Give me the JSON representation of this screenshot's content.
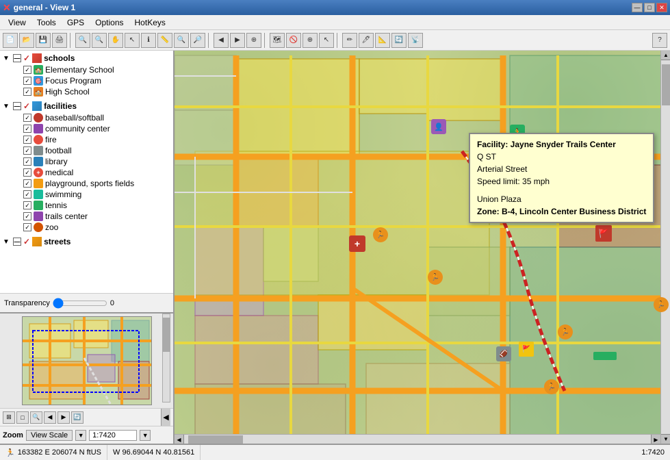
{
  "titleBar": {
    "title": "general - View 1",
    "minBtn": "—",
    "maxBtn": "□",
    "closeBtn": "✕"
  },
  "menuBar": {
    "items": [
      "View",
      "Tools",
      "GPS",
      "Options",
      "HotKeys"
    ]
  },
  "toolbar": {
    "helpBtn": "?"
  },
  "layerTree": {
    "schools": {
      "label": "schools",
      "children": [
        {
          "label": "Elementary School",
          "iconColor": "#27ae60",
          "iconShape": "square"
        },
        {
          "label": "Focus Program",
          "iconColor": "#3498db",
          "iconShape": "square"
        },
        {
          "label": "High School",
          "iconColor": "#e67e22",
          "iconShape": "square"
        }
      ]
    },
    "facilities": {
      "label": "facilities",
      "children": [
        {
          "label": "baseball/softball",
          "iconColor": "#c0392b",
          "iconShape": "circle"
        },
        {
          "label": "community center",
          "iconColor": "#8e44ad",
          "iconShape": "square"
        },
        {
          "label": "fire",
          "iconColor": "#e74c3c",
          "iconShape": "circle"
        },
        {
          "label": "football",
          "iconColor": "#7f8c8d",
          "iconShape": "square"
        },
        {
          "label": "library",
          "iconColor": "#2980b9",
          "iconShape": "square"
        },
        {
          "label": "medical",
          "iconColor": "#e74c3c",
          "iconShape": "circle"
        },
        {
          "label": "playground, sports fields",
          "iconColor": "#f39c12",
          "iconShape": "square"
        },
        {
          "label": "swimming",
          "iconColor": "#1abc9c",
          "iconShape": "square"
        },
        {
          "label": "tennis",
          "iconColor": "#27ae60",
          "iconShape": "square"
        },
        {
          "label": "trails center",
          "iconColor": "#8e44ad",
          "iconShape": "square"
        },
        {
          "label": "zoo",
          "iconColor": "#d35400",
          "iconShape": "circle"
        }
      ]
    },
    "streets": {
      "label": "streets"
    }
  },
  "transparency": {
    "label": "Transparency",
    "value": 0
  },
  "zoom": {
    "label": "Zoom",
    "scaleLabel": "View Scale",
    "value": "1:7420",
    "arrowDown": "▼"
  },
  "popup": {
    "facility": "Facility: Jayne Snyder Trails Center",
    "street1": "Q ST",
    "street2": "Arterial Street",
    "speedLimit": "Speed limit: 35 mph",
    "blank": "",
    "zone1": "Union Plaza",
    "zone2": "Zone: B-4, Lincoln Center Business District"
  },
  "statusBar": {
    "icon": "🏃",
    "coords1": "163382 E  206074 N ftUS",
    "coords2": "W 96.69044  N 40.81561",
    "scale": "1:7420"
  },
  "bottomToolbar": {
    "buttons": [
      "⊞",
      "□",
      "🔍",
      "◀",
      "▶",
      "🔄"
    ]
  }
}
